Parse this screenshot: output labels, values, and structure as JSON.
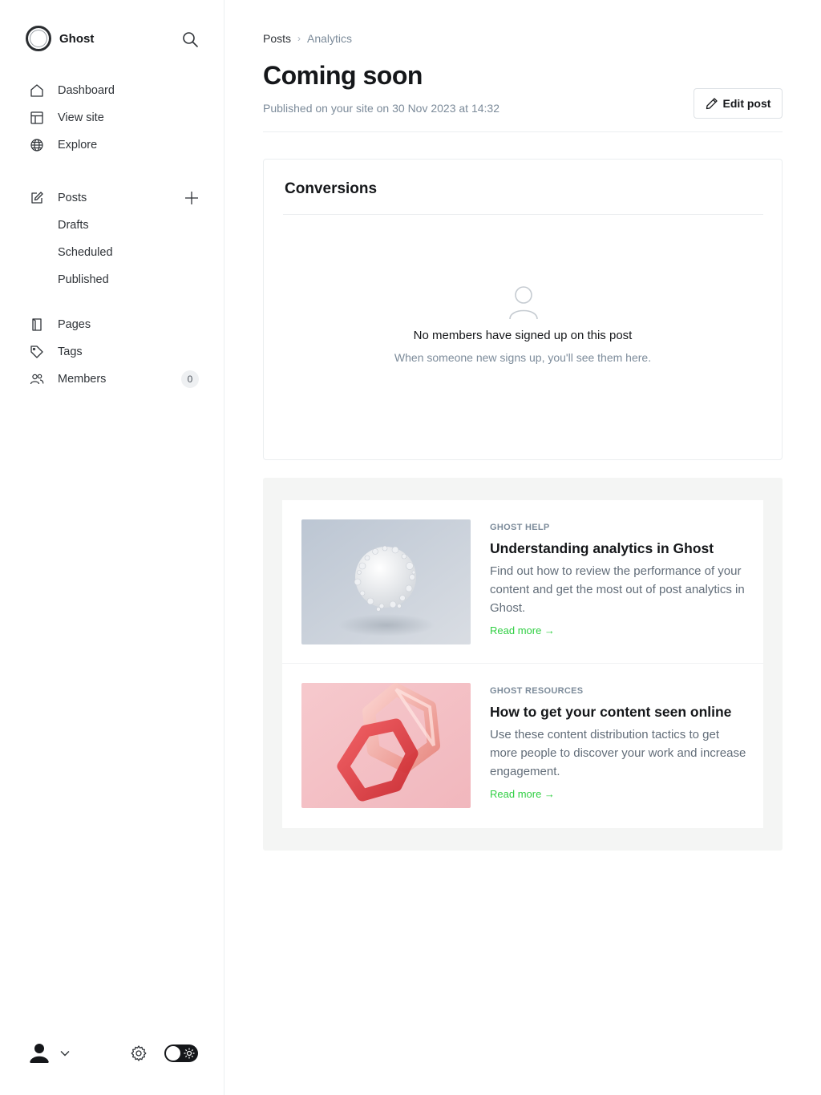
{
  "brand": {
    "name": "Ghost"
  },
  "sidebar": {
    "top_items": [
      {
        "label": "Dashboard",
        "icon": "home-icon"
      },
      {
        "label": "View site",
        "icon": "layout-icon"
      },
      {
        "label": "Explore",
        "icon": "globe-icon"
      }
    ],
    "posts": {
      "label": "Posts",
      "children": [
        "Drafts",
        "Scheduled",
        "Published"
      ]
    },
    "bottom_items": [
      {
        "label": "Pages",
        "icon": "pages-icon"
      },
      {
        "label": "Tags",
        "icon": "tag-icon"
      },
      {
        "label": "Members",
        "icon": "members-icon",
        "badge": "0"
      }
    ]
  },
  "breadcrumb": {
    "parent": "Posts",
    "separator": "›",
    "current": "Analytics"
  },
  "post": {
    "title": "Coming soon",
    "published_text": "Published on your site on 30 Nov 2023 at 14:32",
    "edit_label": "Edit post"
  },
  "conversions": {
    "title": "Conversions",
    "empty_title": "No members have signed up on this post",
    "empty_subtitle": "When someone new signs up, you'll see them here."
  },
  "help": [
    {
      "eyebrow": "Ghost Help",
      "title": "Understanding analytics in Ghost",
      "description": "Find out how to review the performance of your content and get the most out of post analytics in Ghost.",
      "link": "Read more →"
    },
    {
      "eyebrow": "Ghost Resources",
      "title": "How to get your content seen online",
      "description": "Use these content distribution tactics to get more people to discover your work and increase engagement.",
      "link": "Read more →"
    }
  ],
  "colors": {
    "accent_green": "#30cf43",
    "muted": "#7c8b9a",
    "text": "#15171a"
  }
}
